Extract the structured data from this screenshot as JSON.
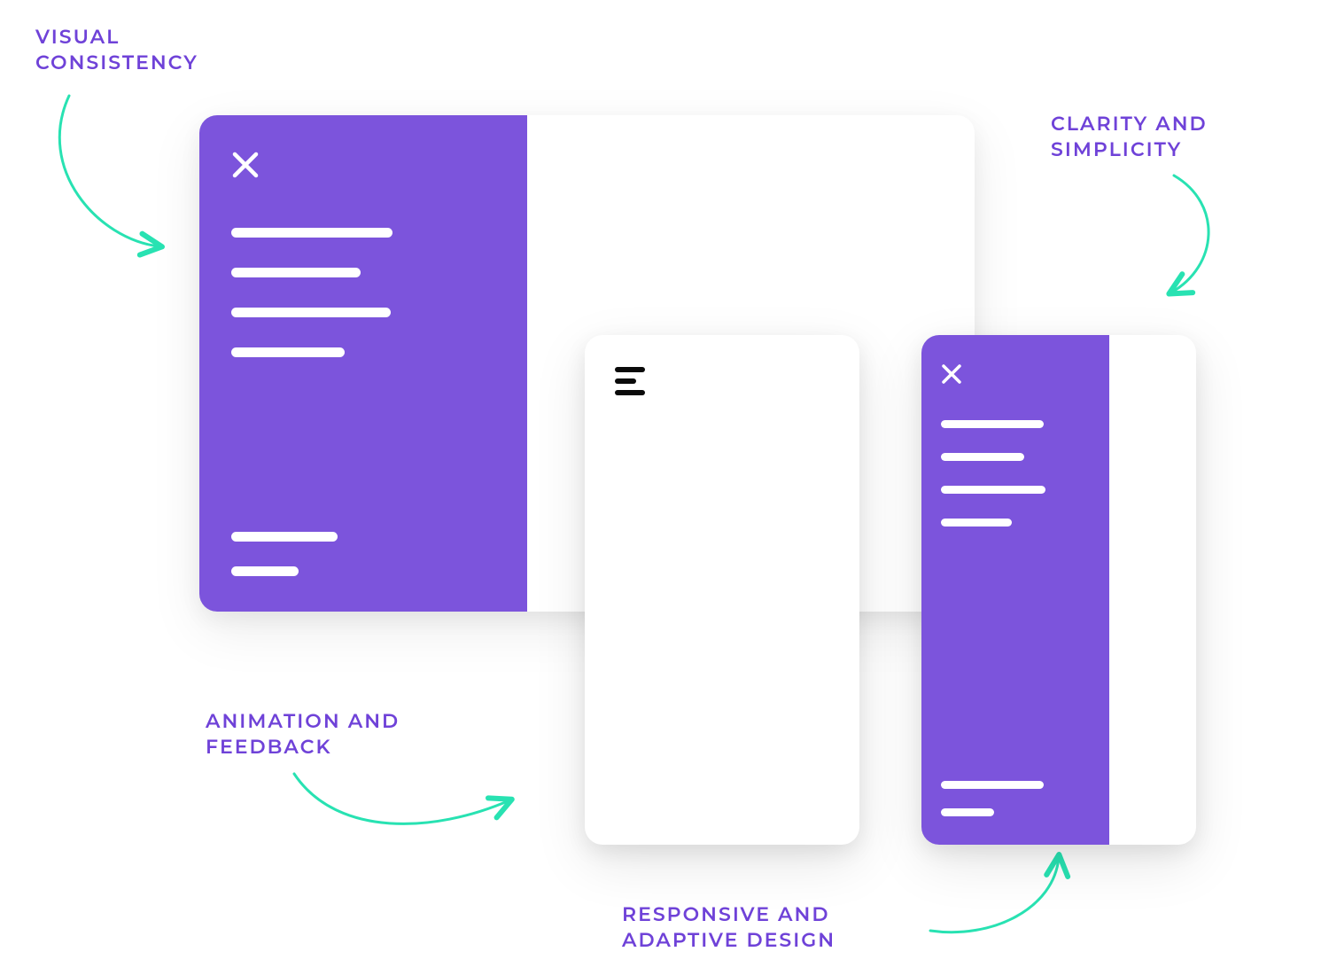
{
  "labels": {
    "visual_consistency": "VISUAL\nCONSISTENCY",
    "clarity_simplicity": "CLARITY AND\nSIMPLICITY",
    "animation_feedback": "ANIMATION AND\nFEEDBACK",
    "responsive_adaptive": "RESPONSIVE AND\nADAPTIVE DESIGN"
  },
  "colors": {
    "accent_purple": "#7C54DC",
    "label_purple": "#6F42D8",
    "arrow_teal": "#28E2B2"
  },
  "cards": {
    "desktop": {
      "type": "desktop-with-sidebar",
      "close": true,
      "menu_top_widths": [
        182,
        146,
        180,
        128
      ],
      "menu_bottom_widths": [
        120,
        76
      ]
    },
    "mobile_hamburger": {
      "type": "mobile-collapsed",
      "icon": "hamburger"
    },
    "mobile_expanded": {
      "type": "mobile-with-sidebar",
      "close": true,
      "menu_top_widths": [
        116,
        94,
        118,
        80
      ],
      "menu_bottom_widths": [
        116,
        60
      ]
    }
  }
}
